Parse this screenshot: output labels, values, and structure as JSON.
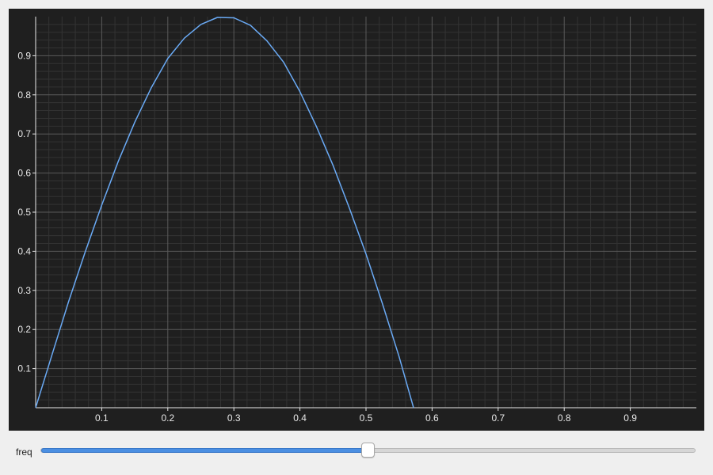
{
  "chart_data": {
    "type": "line",
    "title": "",
    "xlabel": "",
    "ylabel": "",
    "xlim": [
      0,
      1.0
    ],
    "ylim": [
      0,
      1.0
    ],
    "x_ticks": [
      0.1,
      0.2,
      0.3,
      0.4,
      0.5,
      0.6,
      0.7,
      0.8,
      0.9
    ],
    "y_ticks": [
      0.1,
      0.2,
      0.3,
      0.4,
      0.5,
      0.6,
      0.7,
      0.8,
      0.9
    ],
    "x_tick_labels": [
      "0.1",
      "0.2",
      "0.3",
      "0.4",
      "0.5",
      "0.6",
      "0.7",
      "0.8",
      "0.9"
    ],
    "y_tick_labels": [
      "0.1",
      "0.2",
      "0.3",
      "0.4",
      "0.5",
      "0.6",
      "0.7",
      "0.8",
      "0.9"
    ],
    "grid": true,
    "series": [
      {
        "color": "#6aaaf5",
        "x": [
          0,
          0.025,
          0.05,
          0.075,
          0.1,
          0.125,
          0.15,
          0.175,
          0.2,
          0.225,
          0.25,
          0.275,
          0.3,
          0.325,
          0.35,
          0.375,
          0.4,
          0.425,
          0.45,
          0.475,
          0.5,
          0.525,
          0.55,
          0.572
        ],
        "y": [
          0,
          0.137,
          0.272,
          0.398,
          0.518,
          0.63,
          0.73,
          0.818,
          0.893,
          0.945,
          0.98,
          0.998,
          0.997,
          0.978,
          0.938,
          0.884,
          0.808,
          0.719,
          0.62,
          0.51,
          0.393,
          0.265,
          0.131,
          0.0
        ]
      }
    ],
    "colors": {
      "background": "#1f1f1f",
      "grid_major": "#5a5a5a",
      "grid_minor": "#333333",
      "axis": "#e8e8e8",
      "tick_text": "#e8e8e8"
    }
  },
  "controls": {
    "slider_label": "freq",
    "slider_value": 0.5,
    "slider_range": [
      0,
      1
    ],
    "colors": {
      "fill": "#4b8fe2"
    }
  }
}
